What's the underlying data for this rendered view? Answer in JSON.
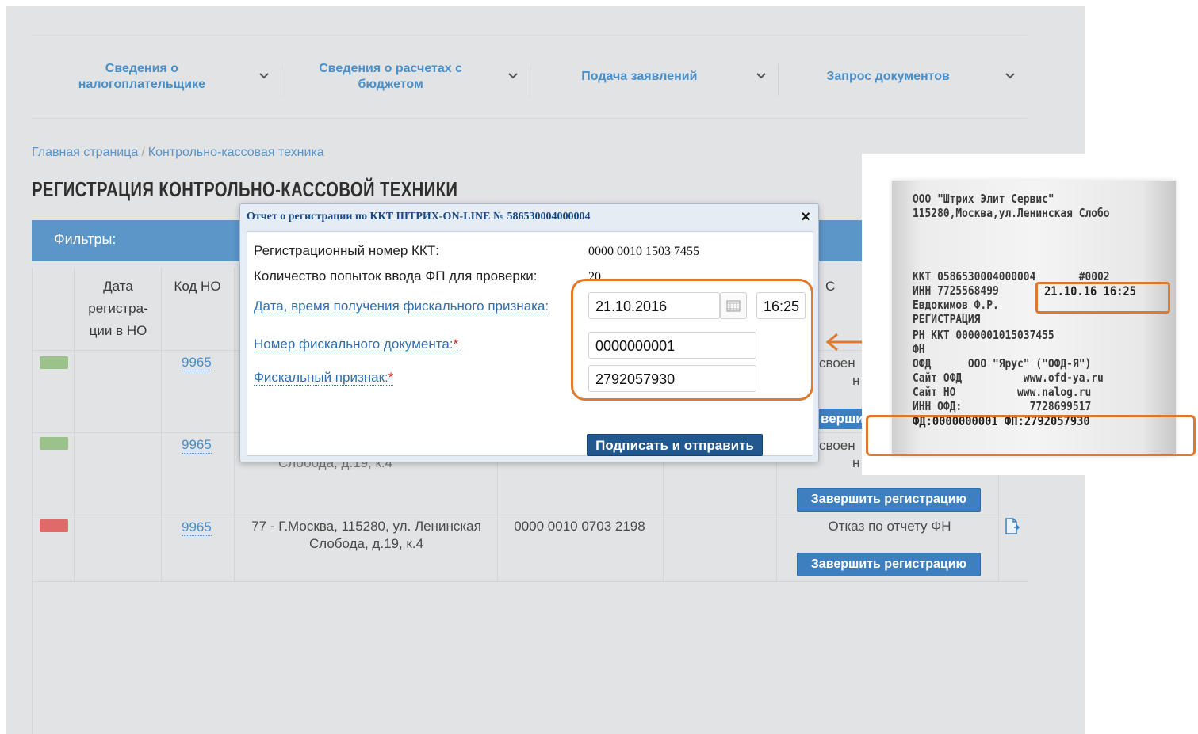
{
  "nav": {
    "items": [
      {
        "label": "Сведения о налогоплательщике"
      },
      {
        "label": "Сведения о расчетах с бюджетом"
      },
      {
        "label": "Подача заявлений"
      },
      {
        "label": "Запрос документов"
      }
    ],
    "chevron": "⌄"
  },
  "breadcrumb": {
    "home": "Главная страница",
    "sep": "/",
    "current": "Контрольно-кассовая техника"
  },
  "page_title": "РЕГИСТРАЦИЯ КОНТРОЛЬНО-КАССОВОЙ ТЕХНИКИ",
  "filters_label": "Фильтры:",
  "table": {
    "headers": {
      "date": "Дата регистра-ции в НО",
      "code": "Код НО",
      "status_partial": "С"
    },
    "rows": [
      {
        "status_color": "#9bc28a",
        "code": "9965",
        "status_text_partial": "своен",
        "status_text_partial2": "н",
        "finish_partial": "верши"
      },
      {
        "status_color": "#9bc28a",
        "code": "9965",
        "address_partial": "Слобода, д.19, к.4",
        "status_text_partial": "своен",
        "status_text_partial2": "н",
        "finish_button": "Завершить регистрацию"
      },
      {
        "status_color": "#e06a6a",
        "code": "9965",
        "address_line1": "77 - Г.Москва, 115280, ул. Ленинская",
        "address_line2": "Слобода, д.19, к.4",
        "reg_number": "0000 0010 0703 2198",
        "status_text": "Отказ по отчету ФН",
        "finish_button": "Завершить регистрацию"
      }
    ]
  },
  "modal": {
    "title": "Отчет о регистрации по ККТ ШТРИХ-ON-LINE № 586530004000004",
    "close": "×",
    "reg_number_label": "Регистрационный номер ККТ:",
    "reg_number_value": "0000 0010 1503 7455",
    "attempts_label": "Количество попыток ввода ФП для проверки:",
    "attempts_value": "20",
    "datetime_label": "Дата, время получения фискального признака:",
    "date_value": "21.10.2016",
    "time_value": "16:25",
    "doc_number_label": "Номер фискального документа:",
    "doc_number_value": "0000000001",
    "fiscal_sign_label": "Фискальный признак:",
    "fiscal_sign_value": "2792057930",
    "required_mark": "*",
    "submit_button": "Подписать и отправить"
  },
  "receipt": {
    "lines": [
      "ООО \"Штрих Элит Сервис\"",
      "115280,Москва,ул.Ленинская Слобо",
      "ККТ 0586530004000004       #0002",
      "ИНН 7725568499",
      "Евдокимов Ф.Р.",
      "РЕГИСТРАЦИЯ",
      "РН ККТ 0000001015037455",
      "ФН",
      "ОФД      ООО \"Ярус\" (\"ОФД-Я\")",
      "Сайт ОФД          www.ofd-ya.ru",
      "Сайт НО          www.nalog.ru",
      "ИНН ОФД:           7728699517",
      "ФД:0000000001 ФП:2792057930"
    ],
    "datetime": "21.10.16 16:25"
  },
  "colors": {
    "accent": "#5c95c8",
    "highlight": "#e0782e",
    "submit": "#23588f"
  }
}
